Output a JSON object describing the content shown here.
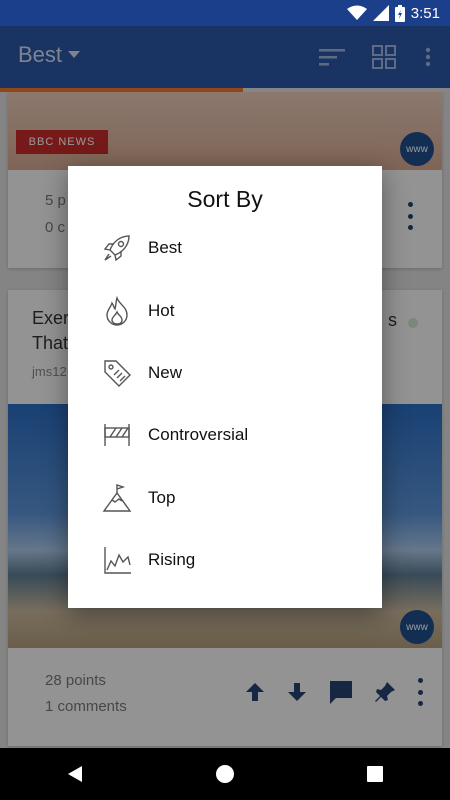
{
  "status": {
    "time": "3:51"
  },
  "appbar": {
    "title": "Best",
    "sort_icon": "sort-icon",
    "grid_icon": "grid-view-icon",
    "more_icon": "more-vert-icon"
  },
  "progress": {
    "fraction": 0.54
  },
  "feed": {
    "card1": {
      "source_logo_text": "BBC NEWS",
      "domain_badge": "www",
      "points_partial": "5 p",
      "comments_partial": "0 c"
    },
    "card2": {
      "title_partial": "Exer",
      "title_partial_line2": "That",
      "title_tail": "s",
      "author_partial": "jms12",
      "domain_badge": "www",
      "points": "28 points",
      "comments": "1 comments"
    }
  },
  "dialog": {
    "title": "Sort By",
    "options": [
      {
        "label": "Best",
        "icon": "rocket-icon"
      },
      {
        "label": "Hot",
        "icon": "flame-icon"
      },
      {
        "label": "New",
        "icon": "tag-icon"
      },
      {
        "label": "Controversial",
        "icon": "barrier-icon"
      },
      {
        "label": "Top",
        "icon": "mountain-flag-icon"
      },
      {
        "label": "Rising",
        "icon": "rising-chart-icon"
      }
    ]
  },
  "colors": {
    "appbar": "#2b55a5",
    "statusbar": "#1c3f8c",
    "accent": "#f07828",
    "icon_dark": "#23416f"
  }
}
